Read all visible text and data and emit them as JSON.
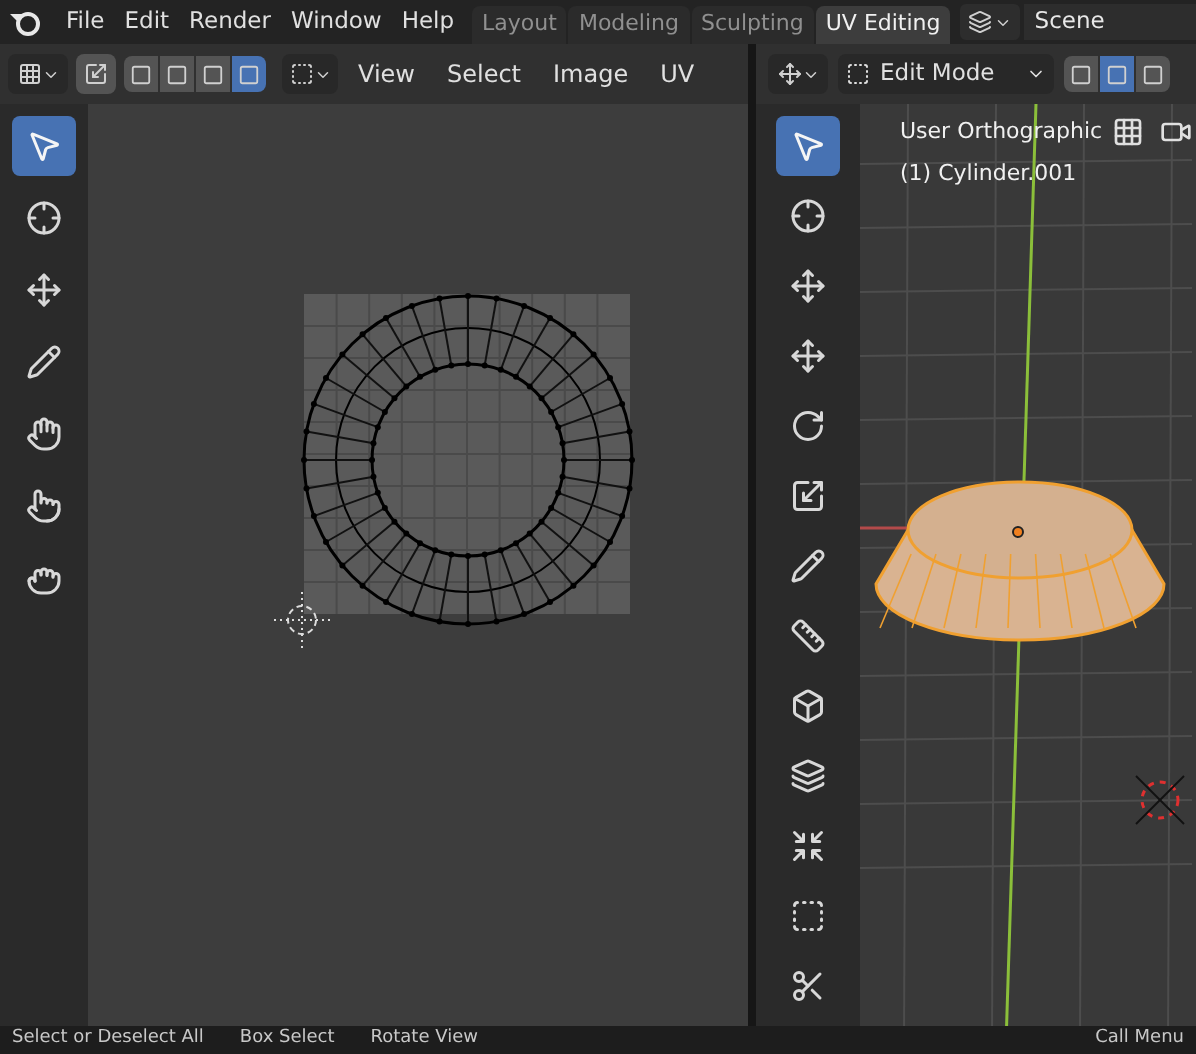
{
  "menu": [
    "File",
    "Edit",
    "Render",
    "Window",
    "Help"
  ],
  "workspace_tabs": [
    {
      "label": "Layout",
      "selected": false
    },
    {
      "label": "Modeling",
      "selected": false
    },
    {
      "label": "Sculpting",
      "selected": false
    },
    {
      "label": "UV Editing",
      "selected": true
    }
  ],
  "scene": "Scene",
  "uv_editor": {
    "header_menus": [
      "View",
      "Select",
      "Image",
      "UV"
    ],
    "select_modes": [
      {
        "selected": false
      },
      {
        "selected": false
      },
      {
        "selected": false
      },
      {
        "selected": true
      }
    ],
    "tools": [
      {
        "kind": "select",
        "selected": true
      },
      {
        "kind": "cursor",
        "selected": false
      },
      {
        "kind": "transform",
        "selected": false
      },
      {
        "kind": "annotate",
        "selected": false
      },
      {
        "kind": "grab",
        "selected": false
      },
      {
        "kind": "pinch",
        "selected": false
      },
      {
        "kind": "relax",
        "selected": false
      }
    ]
  },
  "viewport": {
    "mode": "Edit Mode",
    "select_modes": [
      {
        "selected": false
      },
      {
        "selected": true
      },
      {
        "selected": false
      }
    ],
    "overlay_lines": [
      "User Orthographic",
      "(1) Cylinder.001"
    ],
    "tools": [
      {
        "kind": "select",
        "selected": true
      },
      {
        "kind": "cursor",
        "selected": false
      },
      {
        "kind": "transform",
        "selected": false
      },
      {
        "kind": "move",
        "selected": false
      },
      {
        "kind": "rotate",
        "selected": false
      },
      {
        "kind": "scale",
        "selected": false
      },
      {
        "kind": "annotate",
        "selected": false
      },
      {
        "kind": "measure",
        "selected": false
      },
      {
        "kind": "add-cube",
        "selected": false
      },
      {
        "kind": "extrude",
        "selected": false
      },
      {
        "kind": "inset",
        "selected": false
      },
      {
        "kind": "bevel",
        "selected": false
      },
      {
        "kind": "loop-cut",
        "selected": false
      }
    ]
  },
  "status_bar": [
    "Select or Deselect All",
    "Box Select",
    "Rotate View",
    "Call Menu"
  ]
}
